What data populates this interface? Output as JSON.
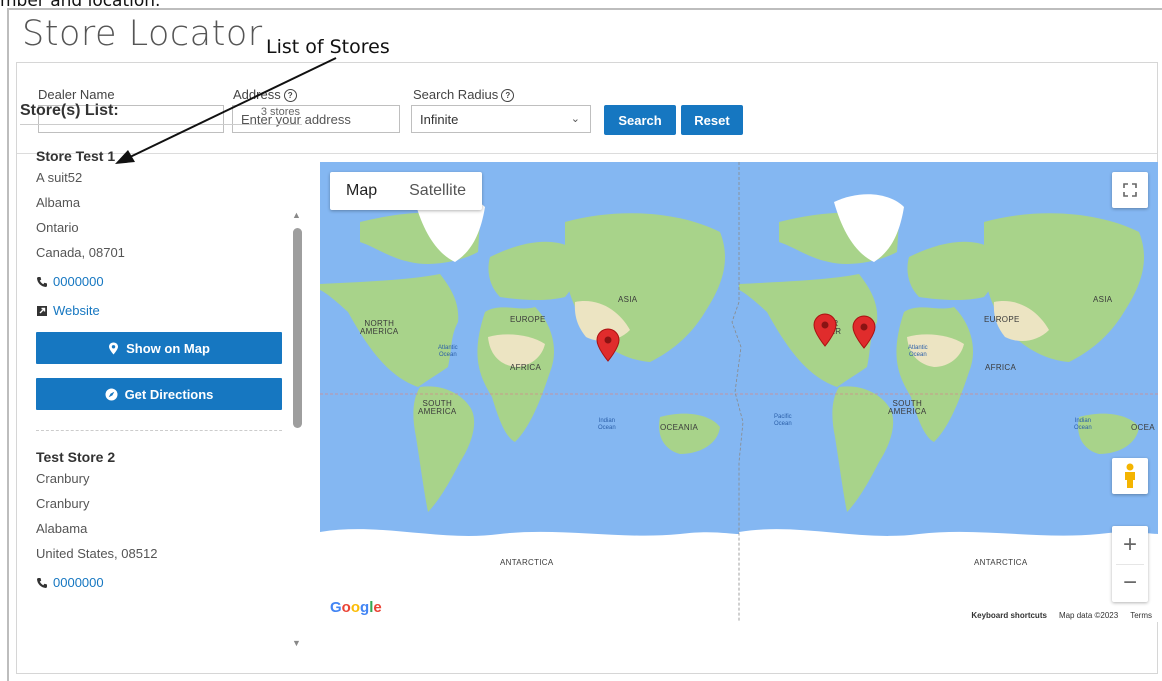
{
  "caption": "mber and location.",
  "page_title": "Store Locator",
  "annotation": "List of Stores",
  "search": {
    "dealer_name_label": "Dealer Name",
    "dealer_name_value": "",
    "address_label": "Address",
    "address_placeholder": "Enter your address",
    "radius_label": "Search Radius",
    "radius_value": "Infinite",
    "search_button": "Search",
    "reset_button": "Reset",
    "help_glyph": "?"
  },
  "list": {
    "title": "Store(s) List:",
    "count": "3 stores",
    "show_on_map": "Show on Map",
    "get_directions": "Get Directions",
    "stores": [
      {
        "name": "Store Test 1",
        "line1": "A suit52",
        "line2": "Albama",
        "line3": "Ontario",
        "line4": "Canada, 08701",
        "phone": "0000000",
        "website": "Website"
      },
      {
        "name": "Test Store 2",
        "line1": "Cranbury",
        "line2": "Cranbury",
        "line3": "Alabama",
        "line4": "United States, 08512",
        "phone": "0000000"
      }
    ]
  },
  "map": {
    "tab_map": "Map",
    "tab_satellite": "Satellite",
    "zoom_in": "+",
    "zoom_out": "−",
    "google": [
      "G",
      "o",
      "o",
      "g",
      "l",
      "e"
    ],
    "google_colors": [
      "#4285F4",
      "#EA4335",
      "#FBBC05",
      "#4285F4",
      "#34A853",
      "#EA4335"
    ],
    "keyboard_shortcuts": "Keyboard shortcuts",
    "map_data": "Map data ©2023",
    "terms": "Terms",
    "labels": {
      "north_america": [
        "NORTH",
        "AMERICA"
      ],
      "south_america": [
        "SOUTH",
        "AMERICA"
      ],
      "europe": "EUROPE",
      "africa": "AFRICA",
      "asia": "ASIA",
      "oceania": "OCEANIA",
      "oceania_right": "OCEA",
      "antarctica": "ANTARCTICA",
      "atlantic": [
        "Atlantic",
        "Ocean"
      ],
      "indian": [
        "Indian",
        "Ocean"
      ],
      "pacific": [
        "Pacific",
        "Ocean"
      ],
      "north_america_partial": [
        "NOR",
        "AMER"
      ]
    },
    "colors": {
      "water": "#84b7f2",
      "land": "#a8d38a",
      "desert": "#ece4c2",
      "ice": "#ffffff",
      "pin": "#e02c2c"
    }
  },
  "colors": {
    "accent": "#1677c1",
    "title_gray": "#555555"
  }
}
